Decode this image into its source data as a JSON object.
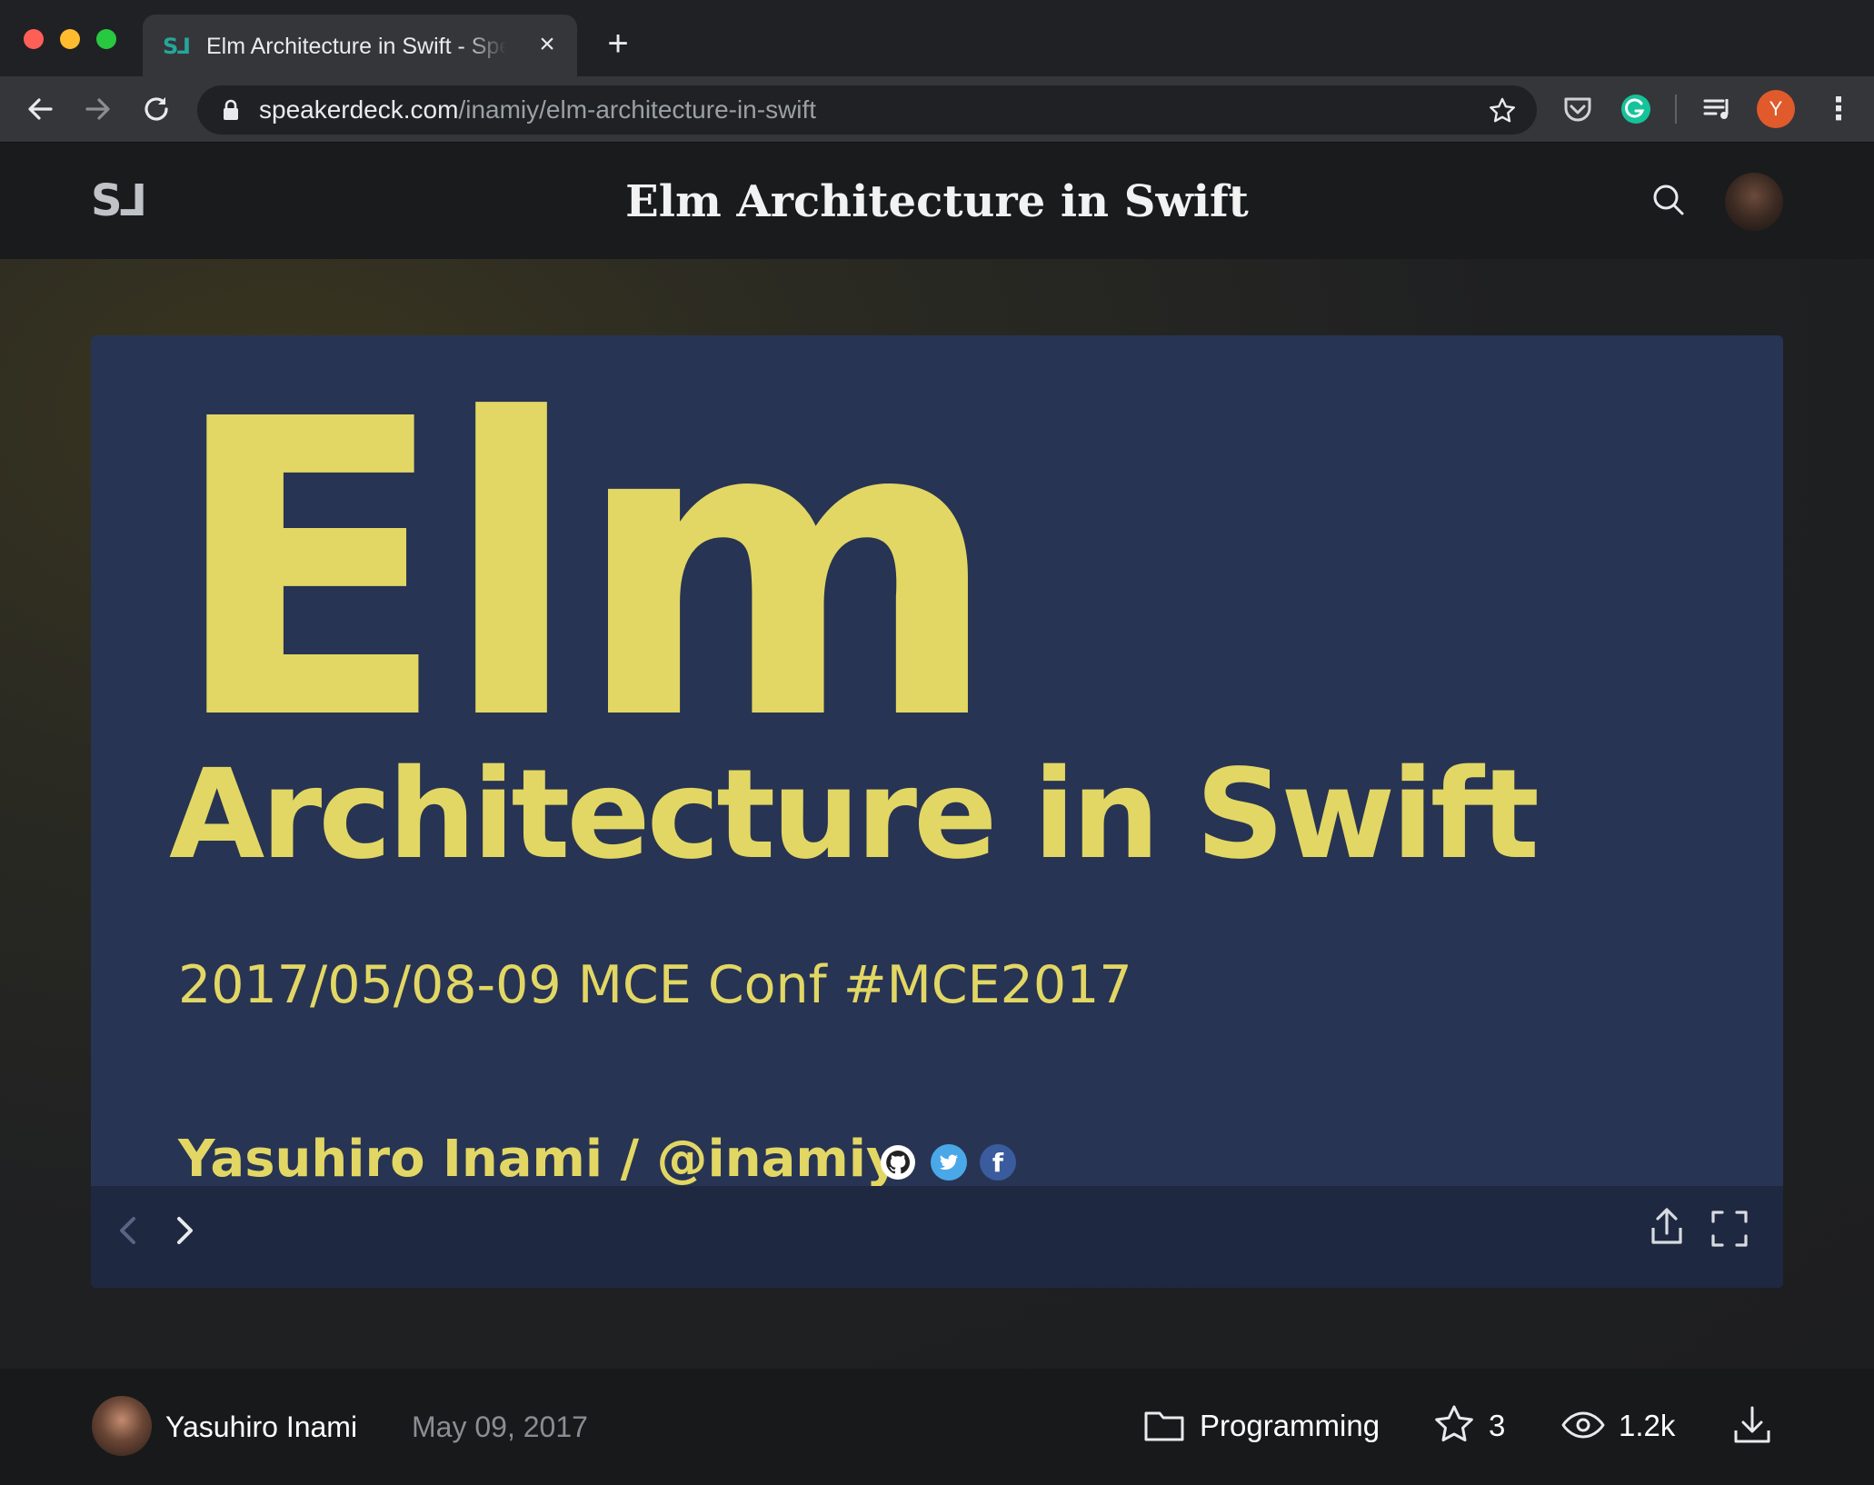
{
  "browser": {
    "tab": {
      "favicon": "S⅃",
      "title": "Elm Architecture in Swift - Speaker Deck",
      "close_glyph": "×"
    },
    "new_tab_glyph": "+",
    "address": {
      "host": "speakerdeck.com",
      "path": "/inamiy/elm-architecture-in-swift"
    },
    "profile_initial": "Y",
    "menu_glyph": "⋮",
    "icons": [
      "back-icon",
      "forward-icon",
      "reload-icon",
      "lock-icon",
      "star-icon",
      "pocket-icon",
      "grammarly-icon",
      "reading-list-icon",
      "menu-icon"
    ]
  },
  "site": {
    "logo": "S⅃",
    "title": "Elm Architecture in Swift"
  },
  "slide": {
    "title_big": "Elm",
    "subtitle": "Architecture in Swift",
    "conference": "2017/05/08-09 MCE Conf #MCE2017",
    "author": "Yasuhiro Inami / @inamiy",
    "facebook_glyph": "f",
    "colors": {
      "background": "#283453",
      "text": "#e2d764"
    }
  },
  "footer": {
    "author_name": "Yasuhiro Inami",
    "date": "May 09, 2017",
    "category": "Programming",
    "stars": "3",
    "views": "1.2k"
  }
}
